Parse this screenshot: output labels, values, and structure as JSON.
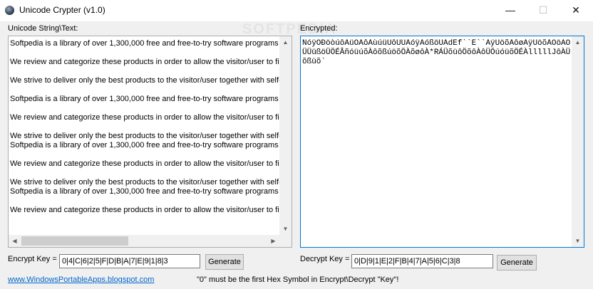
{
  "window": {
    "title": "Unicode Crypter (v1.0)",
    "minimize_glyph": "—",
    "maximize_glyph": "☐",
    "close_glyph": "✕"
  },
  "watermark": "SOFTPEDIA",
  "left_panel": {
    "label": "Unicode String\\Text:",
    "lines": [
      "Softpedia is a library of over 1,300,000 free and free-to-try software programs for",
      "",
      "We review and categorize these products in order to allow the visitor/user to find",
      "",
      "We strive to deliver only the best products to the visitor/user together with self-m",
      "",
      "Softpedia is a library of over 1,300,000 free and free-to-try software programs for",
      "",
      "We review and categorize these products in order to allow the visitor/user to find",
      "",
      "We strive to deliver only the best products to the visitor/user together with self-m",
      "Softpedia is a library of over 1,300,000 free and free-to-try software programs for",
      "",
      "We review and categorize these products in order to allow the visitor/user to find",
      "",
      "We strive to deliver only the best products to the visitor/user together with self-m",
      "Softpedia is a library of over 1,300,000 free and free-to-try software programs for",
      "",
      "We review and categorize these products in order to allow the visitor/user to find"
    ]
  },
  "right_panel": {
    "label": "Encrypted:",
    "text": "ÑóÿÔÐöòúôÀüÖÀôÀùúüÜôÜÚÀóÿÀóßöÜÀdÉf``É``ÀÿÜöõÀôøÀÿÜöõÁÖöÀÖÜÜüßöÜÖÉÂñóüúõÀôõßúöõÖÀõøôÀ*RÁÜõüôÖõôÀôÜÖúóüõÖÉÀlllllJôÀÜõßüõ`"
  },
  "encrypt": {
    "label": "Encrypt Key =",
    "value": "0|4|C|6|2|5|F|D|B|A|7|E|9|1|8|3",
    "button": "Generate"
  },
  "decrypt": {
    "label": "Decrypt Key =",
    "value": "0|D|9|1|E|2|F|B|4|7|A|5|6|C|3|8",
    "button": "Generate"
  },
  "footer": {
    "link": "www.WindowsPortableApps.blogspot.com",
    "note": "\"0\" must be the first Hex Symbol in Encrypt\\Decrypt \"Key\"!"
  }
}
